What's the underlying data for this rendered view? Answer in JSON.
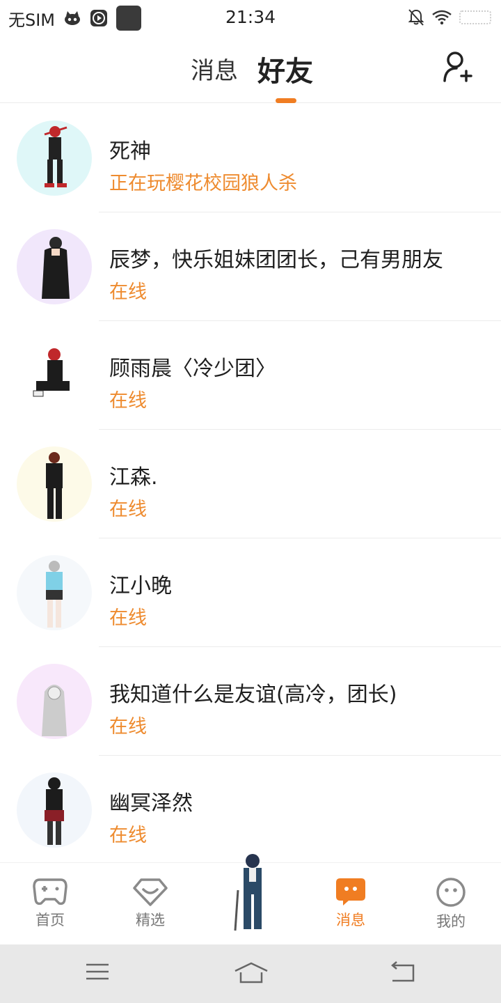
{
  "status_bar": {
    "carrier": "无SIM",
    "time": "21:34",
    "icons": [
      "cat-icon",
      "play-icon",
      "app-square-icon",
      "mute-bell-icon",
      "wifi-icon",
      "battery-icon"
    ]
  },
  "header": {
    "tabs": [
      {
        "label": "消息",
        "active": false
      },
      {
        "label": "好友",
        "active": true
      }
    ],
    "accent": "#f07d22",
    "add_icon": "add-friend-icon"
  },
  "friends": [
    {
      "name": "死神",
      "status": "正在玩樱花校园狼人杀",
      "avatar_bg": "#dff7f8"
    },
    {
      "name": "辰梦，快乐姐妹团团长，己有男朋友",
      "status": "在线",
      "avatar_bg": "#f1e7fb"
    },
    {
      "name": "顾雨晨〈冷少团〉",
      "status": "在线",
      "avatar_bg": "#ffffff"
    },
    {
      "name": "江森.",
      "status": "在线",
      "avatar_bg": "#fdfae8"
    },
    {
      "name": "江小晚",
      "status": "在线",
      "avatar_bg": "#f5f8fb"
    },
    {
      "name": "我知道什么是友谊(高冷，团长)",
      "status": "在线",
      "avatar_bg": "#f8e8fb"
    },
    {
      "name": "幽冥泽然",
      "status": "在线",
      "avatar_bg": "#f2f6fb"
    }
  ],
  "bottom_nav": {
    "items": [
      {
        "label": "首页",
        "icon": "gamepad-icon",
        "active": false
      },
      {
        "label": "精选",
        "icon": "heart-badge-icon",
        "active": false
      },
      {
        "label": "消息",
        "icon": "chat-bubble-icon",
        "active": true
      },
      {
        "label": "我的",
        "icon": "face-icon",
        "active": false
      }
    ]
  },
  "system_nav": {
    "icons": [
      "menu-icon",
      "home-icon",
      "back-icon"
    ]
  },
  "colors": {
    "accent": "#f07d22",
    "status_text": "#ee8b2f",
    "divider": "#ececec"
  }
}
